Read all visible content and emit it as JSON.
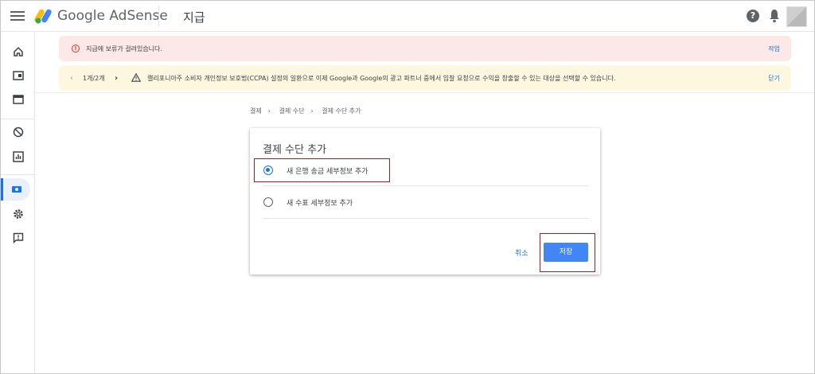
{
  "app": {
    "brand": "Google AdSense",
    "page_title": "지급"
  },
  "header": {
    "help_icon": "help-icon",
    "bell_icon": "bell-icon"
  },
  "rail": [
    {
      "name": "home-icon"
    },
    {
      "name": "ads-icon"
    },
    {
      "name": "sites-icon"
    },
    {
      "name": "blocking-icon"
    },
    {
      "name": "reports-icon"
    },
    {
      "name": "payments-icon",
      "active": true
    },
    {
      "name": "settings-icon"
    },
    {
      "name": "feedback-icon"
    }
  ],
  "banners": {
    "error": {
      "message": "지급에 보류가 걸려있습니다.",
      "action": "작업"
    },
    "notice": {
      "pager": "1개/2개",
      "message": "캘리포니아주 소비자 개인정보 보호법(CCPA) 설정의 일환으로 이제 Google과 Google의 광고 파트너 중에서 입찰 요청으로 수익을 창출할 수 있는 대상을 선택할 수 있습니다.",
      "action": "닫기"
    }
  },
  "breadcrumb": [
    "결제",
    "결제 수단",
    "결제 수단 추가"
  ],
  "dialog": {
    "title": "결제 수단 추가",
    "options": [
      {
        "label": "새 은행 송금 세부정보 추가",
        "selected": true
      },
      {
        "label": "새 수표 세부정보 추가",
        "selected": false
      }
    ],
    "cancel": "취소",
    "save": "저장"
  },
  "colors": {
    "accent": "#1a73e8",
    "button": "#4285f4",
    "highlight": "#a01b22",
    "error_bg": "#fce8e6",
    "notice_bg": "#fef7e0"
  }
}
